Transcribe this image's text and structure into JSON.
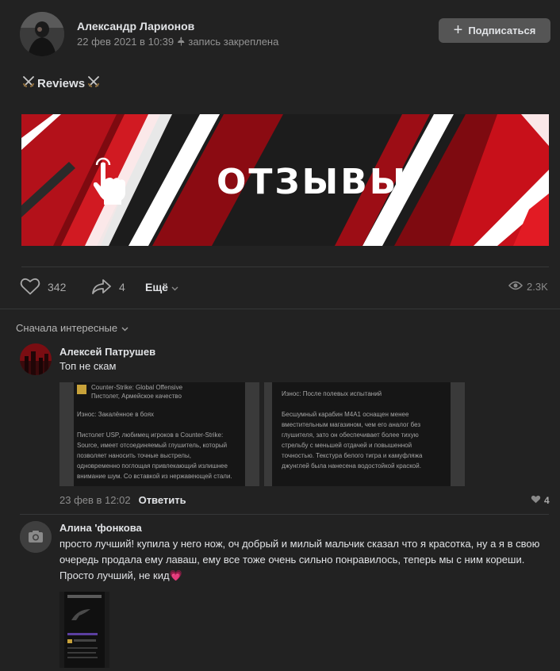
{
  "post": {
    "author": "Александр Ларионов",
    "date": "22 фев 2021 в 10:39",
    "pinned_note": "запись закреплена",
    "subscribe_label": "Подписаться",
    "title": "Reviews",
    "banner_text": "ОТЗЫВЫ"
  },
  "actions": {
    "likes": "342",
    "shares": "4",
    "more_label": "Ещё",
    "views": "2.3K"
  },
  "comments_sort": "Сначала интересные",
  "comments": [
    {
      "author": "Алексей Патрушев",
      "text": "Топ не скам",
      "date": "23 фев в 12:02",
      "reply_label": "Ответить",
      "likes": "4",
      "attachment1": {
        "game": "Counter-Strike: Global Offensive",
        "subtitle": "Пистолет, Армейское качество",
        "wear": "Износ: Закалённое в боях",
        "description": "Пистолет USP, любимец игроков в Counter-Strike: Source, имеет отсоединяемый глушитель, который позволяет наносить точные выстрелы, одновременно поглощая привлекающий излишнее внимание шум. Со вставкой из нержавеющей стали."
      },
      "attachment2": {
        "wear": "Износ: После полевых испытаний",
        "description": "Бесшумный карабин M4A1 оснащен менее вместительным магазином, чем его аналог без глушителя, зато он обеспечивает более тихую стрельбу с меньшей отдачей и повышенной точностью. Текстура белого тигра и камуфляжа джунглей была нанесена водостойкой краской."
      }
    },
    {
      "author": "Алина 'фонкова",
      "text": "просто лучший! купила у него нож, оч добрый и милый мальчик сказал что я красотка, ну а я в свою очередь продала ему лаваш, ему все тоже очень сильно понравилось, теперь мы с ним кореши. Просто лучший, не кид",
      "emoji": "💗"
    }
  ],
  "colors": {
    "background": "#222222",
    "accent_red": "#c8101a",
    "button": "#555555"
  }
}
